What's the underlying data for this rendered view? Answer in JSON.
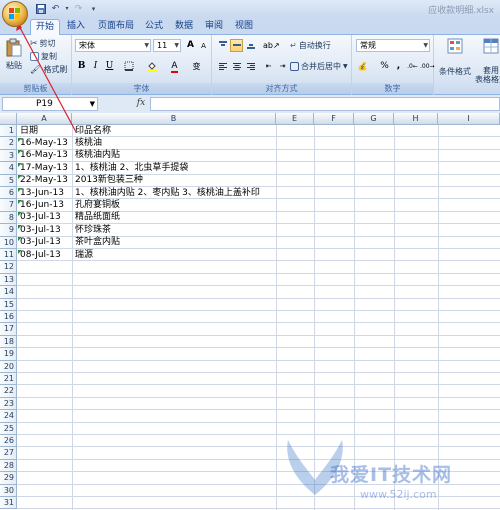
{
  "window": {
    "title": "应收款明细.xlsx"
  },
  "tabs": [
    "开始",
    "插入",
    "页面布局",
    "公式",
    "数据",
    "审阅",
    "视图"
  ],
  "ribbon": {
    "clipboard": {
      "paste": "粘贴",
      "cut": "剪切",
      "copy": "复制",
      "format_painter": "格式刷",
      "label": "剪贴板"
    },
    "font": {
      "name": "宋体",
      "size": "11",
      "bold": "B",
      "italic": "I",
      "underline": "U",
      "grow": "A",
      "shrink": "A",
      "wen": "变",
      "label": "字体"
    },
    "alignment": {
      "wrap": "自动换行",
      "merge": "合并后居中",
      "label": "对齐方式"
    },
    "number": {
      "format": "常规",
      "percent": "%",
      "comma": ",",
      "label": "数字"
    },
    "styles": {
      "conditional": "条件格式",
      "table_format": "套用\n表格格式"
    }
  },
  "formula_bar": {
    "name_box": "P19",
    "fx": "fx",
    "value": ""
  },
  "columns": [
    "A",
    "B",
    "E",
    "F",
    "G",
    "H",
    "I"
  ],
  "rows": [
    "1",
    "2",
    "3",
    "4",
    "5",
    "6",
    "7",
    "8",
    "9",
    "10",
    "11",
    "12",
    "13",
    "14",
    "15",
    "16",
    "17",
    "18",
    "19",
    "20",
    "21",
    "22",
    "23",
    "24",
    "25",
    "26",
    "27",
    "28",
    "29",
    "30",
    "31"
  ],
  "cells": [
    {
      "a": "日期",
      "b": "印品名称"
    },
    {
      "a": "16-May-13",
      "b": "核桃油"
    },
    {
      "a": "16-May-13",
      "b": "核桃油内贴"
    },
    {
      "a": "17-May-13",
      "b": "1、核桃油      2、北虫草手提袋"
    },
    {
      "a": "22-May-13",
      "b": "2013新包装三种"
    },
    {
      "a": "13-Jun-13",
      "b": "1、核桃油内贴    2、枣内贴    3、核桃油上盖补印"
    },
    {
      "a": "16-Jun-13",
      "b": "孔府宴铜板"
    },
    {
      "a": "03-Jul-13",
      "b": "精品纸面纸"
    },
    {
      "a": "03-Jul-13",
      "b": "怀珍珠茶"
    },
    {
      "a": "03-Jul-13",
      "b": "茶叶盒内贴"
    },
    {
      "a": "08-Jul-13",
      "b": "瑞源"
    }
  ],
  "watermark": {
    "text": "我爱IT技术网",
    "url": "www.52ij.com"
  }
}
